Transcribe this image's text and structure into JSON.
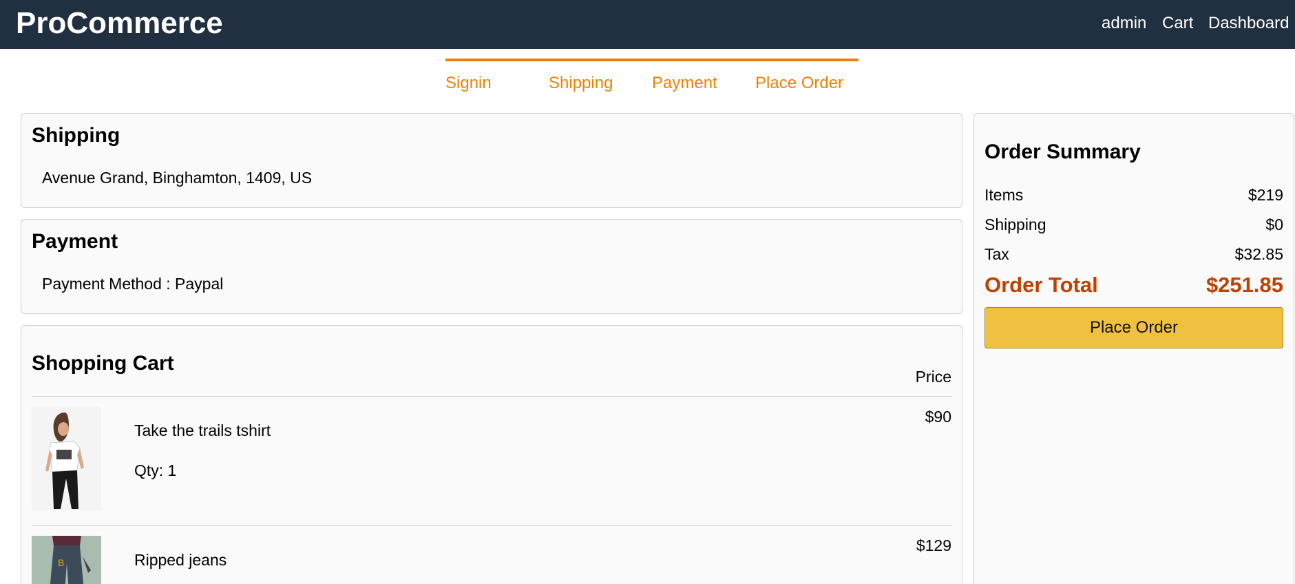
{
  "navbar": {
    "brand": "ProCommerce",
    "links": [
      "admin",
      "Cart",
      "Dashboard"
    ]
  },
  "steps": [
    "Signin",
    "Shipping",
    "Payment",
    "Place Order"
  ],
  "shipping": {
    "title": "Shipping",
    "address": "Avenue Grand, Binghamton, 1409, US"
  },
  "payment": {
    "title": "Payment",
    "method": "Payment Method : Paypal"
  },
  "cart": {
    "title": "Shopping Cart",
    "price_header": "Price",
    "items": [
      {
        "name": "Take the trails tshirt",
        "qty": "Qty: 1",
        "price": "$90"
      },
      {
        "name": "Ripped jeans",
        "price": "$129"
      }
    ]
  },
  "summary": {
    "title": "Order Summary",
    "items_label": "Items",
    "items_value": "$219",
    "shipping_label": "Shipping",
    "shipping_value": "$0",
    "tax_label": "Tax",
    "tax_value": "$32.85",
    "total_label": "Order Total",
    "total_value": "$251.85",
    "button": "Place Order"
  },
  "colors": {
    "navbar": "#203040",
    "accent": "#f08000",
    "total": "#c04000",
    "button": "#f0c040"
  }
}
